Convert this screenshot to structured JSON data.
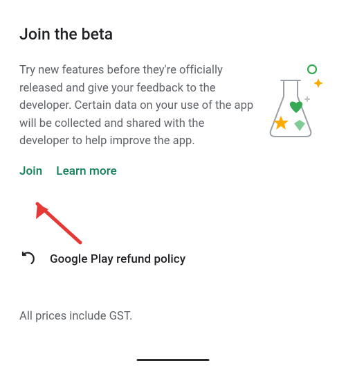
{
  "beta": {
    "title": "Join the beta",
    "description": "Try new features before they're officially released and give your feedback to the developer. Certain data on your use of the app will be collected and shared with the developer to help improve the app.",
    "join_label": "Join",
    "learn_more_label": "Learn more"
  },
  "refund": {
    "label": "Google Play refund policy"
  },
  "footer": {
    "gst_note": "All prices include GST."
  },
  "icons": {
    "beaker": "beaker-icon",
    "undo": "undo-icon"
  },
  "annotation": {
    "arrow_color": "#E53935"
  }
}
